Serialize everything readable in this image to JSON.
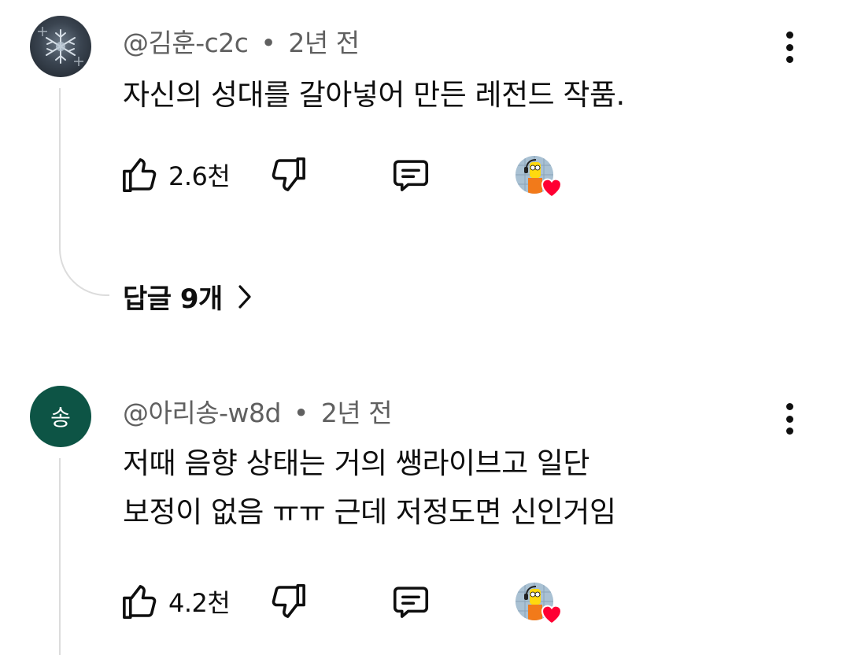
{
  "comments": [
    {
      "author": "@김훈-c2c",
      "separator": "•",
      "time": "2년 전",
      "text_lines": [
        "자신의 성대를 갈아넣어 만든 레전드 작품."
      ],
      "likes": "2.6천",
      "avatar_letter": "",
      "replies_label": "답글 9개"
    },
    {
      "author": "@아리송-w8d",
      "separator": "•",
      "time": "2년 전",
      "text_lines": [
        "저때 음향 상태는 거의 쌩라이브고 일단",
        "보정이 없음 ㅠㅠ 근데 저정도면 신인거임"
      ],
      "likes": "4.2천",
      "avatar_letter": "송",
      "avatar_color": "#0d5445"
    }
  ],
  "icons": {
    "like": "thumbs-up-icon",
    "dislike": "thumbs-down-icon",
    "reply": "comment-icon",
    "more": "more-vert-icon",
    "creator_heart": "heart-icon",
    "expand": "chevron-right-icon"
  },
  "colors": {
    "heart": "#ff0033",
    "meta_text": "#606060",
    "thread_line": "#dcdcdc"
  }
}
